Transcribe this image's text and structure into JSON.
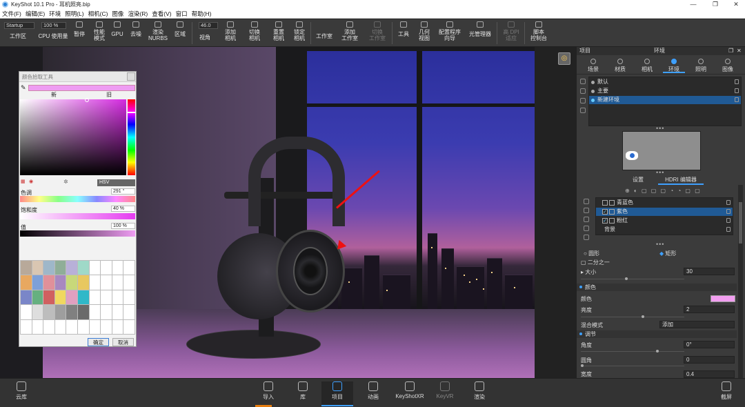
{
  "app": {
    "title": "KeyShot 10.1 Pro - 耳机照亮.bip",
    "min": "—",
    "max": "❐",
    "close": "✕"
  },
  "menu": [
    "文件(F)",
    "编辑(E)",
    "环境",
    "照明(L)",
    "相机(C)",
    "图像",
    "渲染(R)",
    "查看(V)",
    "窗口",
    "帮助(H)"
  ],
  "toolbar": {
    "preset": "Startup",
    "zoom": "100 %",
    "fov": "46.0",
    "items": {
      "workspace": "工作区",
      "cpu": "CPU 使用量",
      "pause": "暂停",
      "perf": "性能\n模式",
      "gpu": "GPU",
      "denoise": "去噪",
      "nurbs": "渲染\nNURBS",
      "region": "区域",
      "view": "视角",
      "add_cam": "添加\n相机",
      "switch_cam": "切换\n相机",
      "reset_cam": "重置\n相机",
      "lock_cam": "锁定\n相机",
      "studio": "工作室",
      "add_studio": "添加\n工作室",
      "switch_studio": "切换\n工作室",
      "tools": "工具",
      "geo_view": "几何\n视图",
      "config": "配置程序\n向导",
      "light_mgr": "光管理器",
      "dpi": "高 DPI\n适应",
      "script": "脚本\n控制台"
    }
  },
  "colorpicker": {
    "title": "颜色拾取工具",
    "new_label": "新",
    "old_label": "旧",
    "mode": "HSV",
    "hue_label": "色调",
    "hue_value": "291 °",
    "sat_label": "饱和度",
    "sat_value": "40 %",
    "val_label": "值",
    "val_value": "100 %",
    "current_color": "#ee9cf2",
    "swatches": [
      "#b8a99a",
      "#d9c6b2",
      "#9eb7c9",
      "#8fae98",
      "#b8b0d8",
      "#9fd9c8",
      "#ffffff",
      "#ffffff",
      "#ffffff",
      "#ffffff",
      "#e8a860",
      "#7ea0d8",
      "#e0909a",
      "#a888c0",
      "#c8d87a",
      "#e8c860",
      "#ffffff",
      "#ffffff",
      "#ffffff",
      "#ffffff",
      "#7a86c8",
      "#66b080",
      "#d06060",
      "#f0d860",
      "#e0a0c0",
      "#30b8c8",
      "#ffffff",
      "#ffffff",
      "#ffffff",
      "#ffffff",
      "#ffffff",
      "#dedede",
      "#bdbdbd",
      "#9e9e9e",
      "#808080",
      "#6a6a6a",
      "#ffffff",
      "#ffffff",
      "#ffffff",
      "#ffffff",
      "#ffffff",
      "#ffffff",
      "#ffffff",
      "#ffffff",
      "#ffffff",
      "#ffffff",
      "#ffffff",
      "#ffffff",
      "#ffffff",
      "#ffffff"
    ],
    "ok": "确定",
    "cancel": "取消"
  },
  "panel": {
    "left_title": "项目",
    "title": "环境",
    "tabs": [
      "场景",
      "材质",
      "相机",
      "环境",
      "照明",
      "图像"
    ],
    "env_list": [
      {
        "name": "默认"
      },
      {
        "name": "主要"
      },
      {
        "name": "新建环境"
      }
    ],
    "sub_tabs": [
      "设置",
      "HDRI 编辑器"
    ],
    "hdri_tools": "⊕ ◐ ▢ ▢ ▢ ◔ ◔ ▢ ▢",
    "hdri_list": [
      {
        "name": "青蓝色",
        "checked": ""
      },
      {
        "name": "紫色",
        "checked": "✓"
      },
      {
        "name": "粉红",
        "checked": "✓"
      },
      {
        "name": "背景",
        "checked": ""
      }
    ],
    "shape_circle": "圆形",
    "shape_rect": "矩形",
    "half": "二分之一",
    "size_label": "大小",
    "size_value": "30",
    "color_section": "颜色",
    "color_label": "颜色",
    "swatch_color": "#f29ef0",
    "brightness_label": "亮度",
    "brightness_value": "2",
    "blend_label": "混合模式",
    "blend_value": "添加",
    "adjust_section": "调节",
    "angle_label": "角度",
    "angle_value": "0°",
    "round_label": "圆角",
    "round_value": "0",
    "width_label": "宽度",
    "width_value": "0.4"
  },
  "bottom": {
    "cloud": "云库",
    "import": "导入",
    "library": "库",
    "project": "项目",
    "animation": "动画",
    "keyshotxr": "KeyShotXR",
    "render_setting": "KeyVR",
    "render": "渲染",
    "screenshot": "截屏"
  }
}
